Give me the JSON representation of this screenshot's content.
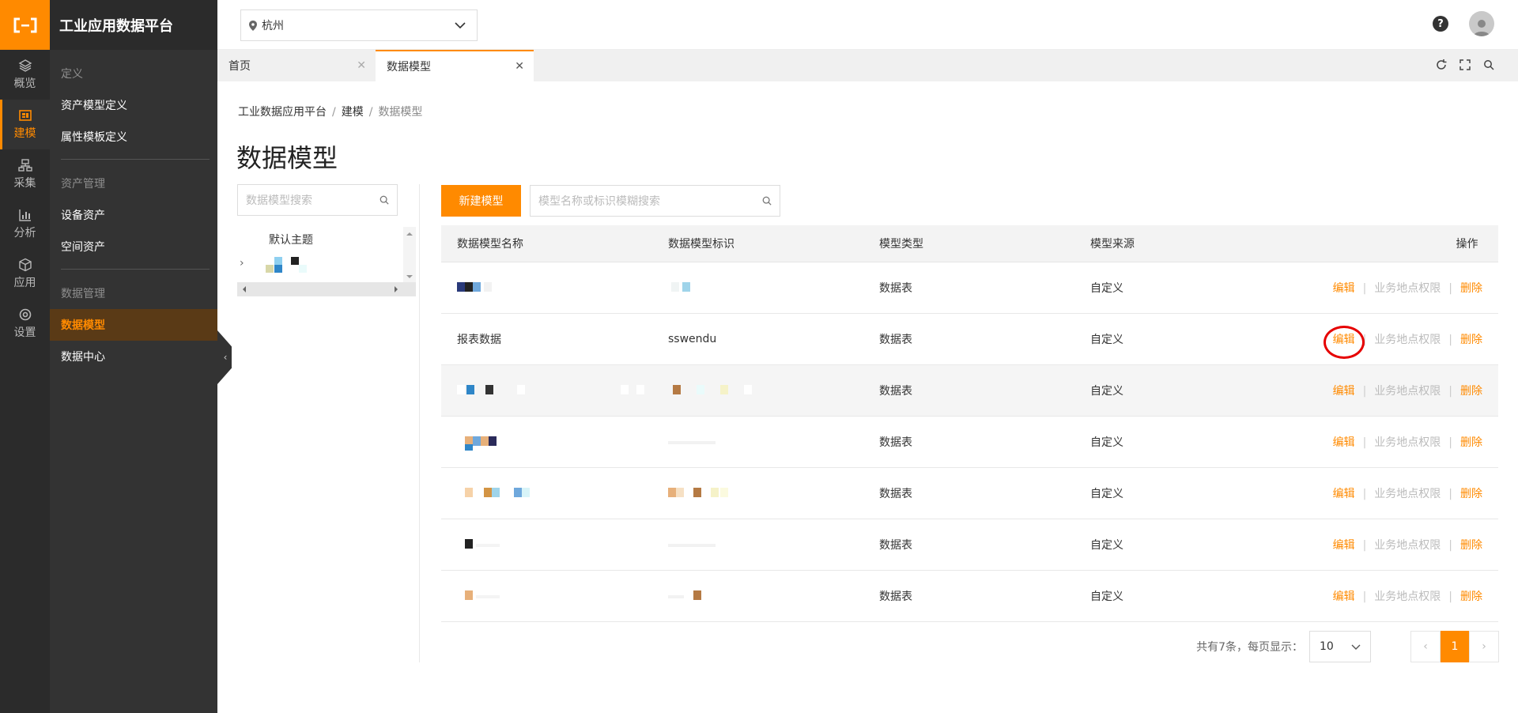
{
  "app": {
    "title": "工业应用数据平台"
  },
  "rail": [
    {
      "label": "概览",
      "icon": "layers-icon"
    },
    {
      "label": "建模",
      "icon": "model-icon",
      "active": true
    },
    {
      "label": "采集",
      "icon": "network-icon"
    },
    {
      "label": "分析",
      "icon": "chart-icon"
    },
    {
      "label": "应用",
      "icon": "cube-icon"
    },
    {
      "label": "设置",
      "icon": "gear-icon"
    }
  ],
  "subnav": {
    "groups": [
      {
        "label": "定义",
        "items": [
          "资产模型定义",
          "属性模板定义"
        ]
      },
      {
        "label": "资产管理",
        "items": [
          "设备资产",
          "空间资产"
        ]
      },
      {
        "label": "数据管理",
        "items": [
          "数据模型",
          "数据中心"
        ]
      }
    ],
    "active_item": "数据模型"
  },
  "topbar": {
    "city": "杭州",
    "help": "?"
  },
  "tabs": [
    {
      "label": "首页"
    },
    {
      "label": "数据模型",
      "active": true
    }
  ],
  "breadcrumb": [
    "工业数据应用平台",
    "建模",
    "数据模型"
  ],
  "page_title": "数据模型",
  "tree": {
    "search_placeholder": "数据模型搜索",
    "root_node": "默认主题"
  },
  "toolbar": {
    "new_button": "新建模型",
    "search_placeholder": "模型名称或标识模糊搜索"
  },
  "table": {
    "headers": [
      "数据模型名称",
      "数据模型标识",
      "模型类型",
      "模型来源",
      "操作"
    ],
    "rows": [
      {
        "name": "",
        "id": "",
        "type": "数据表",
        "source": "自定义"
      },
      {
        "name": "报表数据",
        "id": "sswendu",
        "type": "数据表",
        "source": "自定义"
      },
      {
        "name": "",
        "id": "",
        "type": "数据表",
        "source": "自定义"
      },
      {
        "name": "",
        "id": "",
        "type": "数据表",
        "source": "自定义"
      },
      {
        "name": "",
        "id": "",
        "type": "数据表",
        "source": "自定义"
      },
      {
        "name": "",
        "id": "",
        "type": "数据表",
        "source": "自定义"
      },
      {
        "name": "",
        "id": "",
        "type": "数据表",
        "source": "自定义"
      }
    ],
    "actions": {
      "edit": "编辑",
      "permission": "业务地点权限",
      "delete": "删除"
    }
  },
  "pager": {
    "summary": "共有7条，每页显示：",
    "page_size": "10",
    "current_page": "1"
  },
  "colors": {
    "accent": "#ff8a00",
    "rail_bg": "#2b2b2b",
    "subnav_bg": "#333333",
    "highlight_circle": "#e60000"
  }
}
